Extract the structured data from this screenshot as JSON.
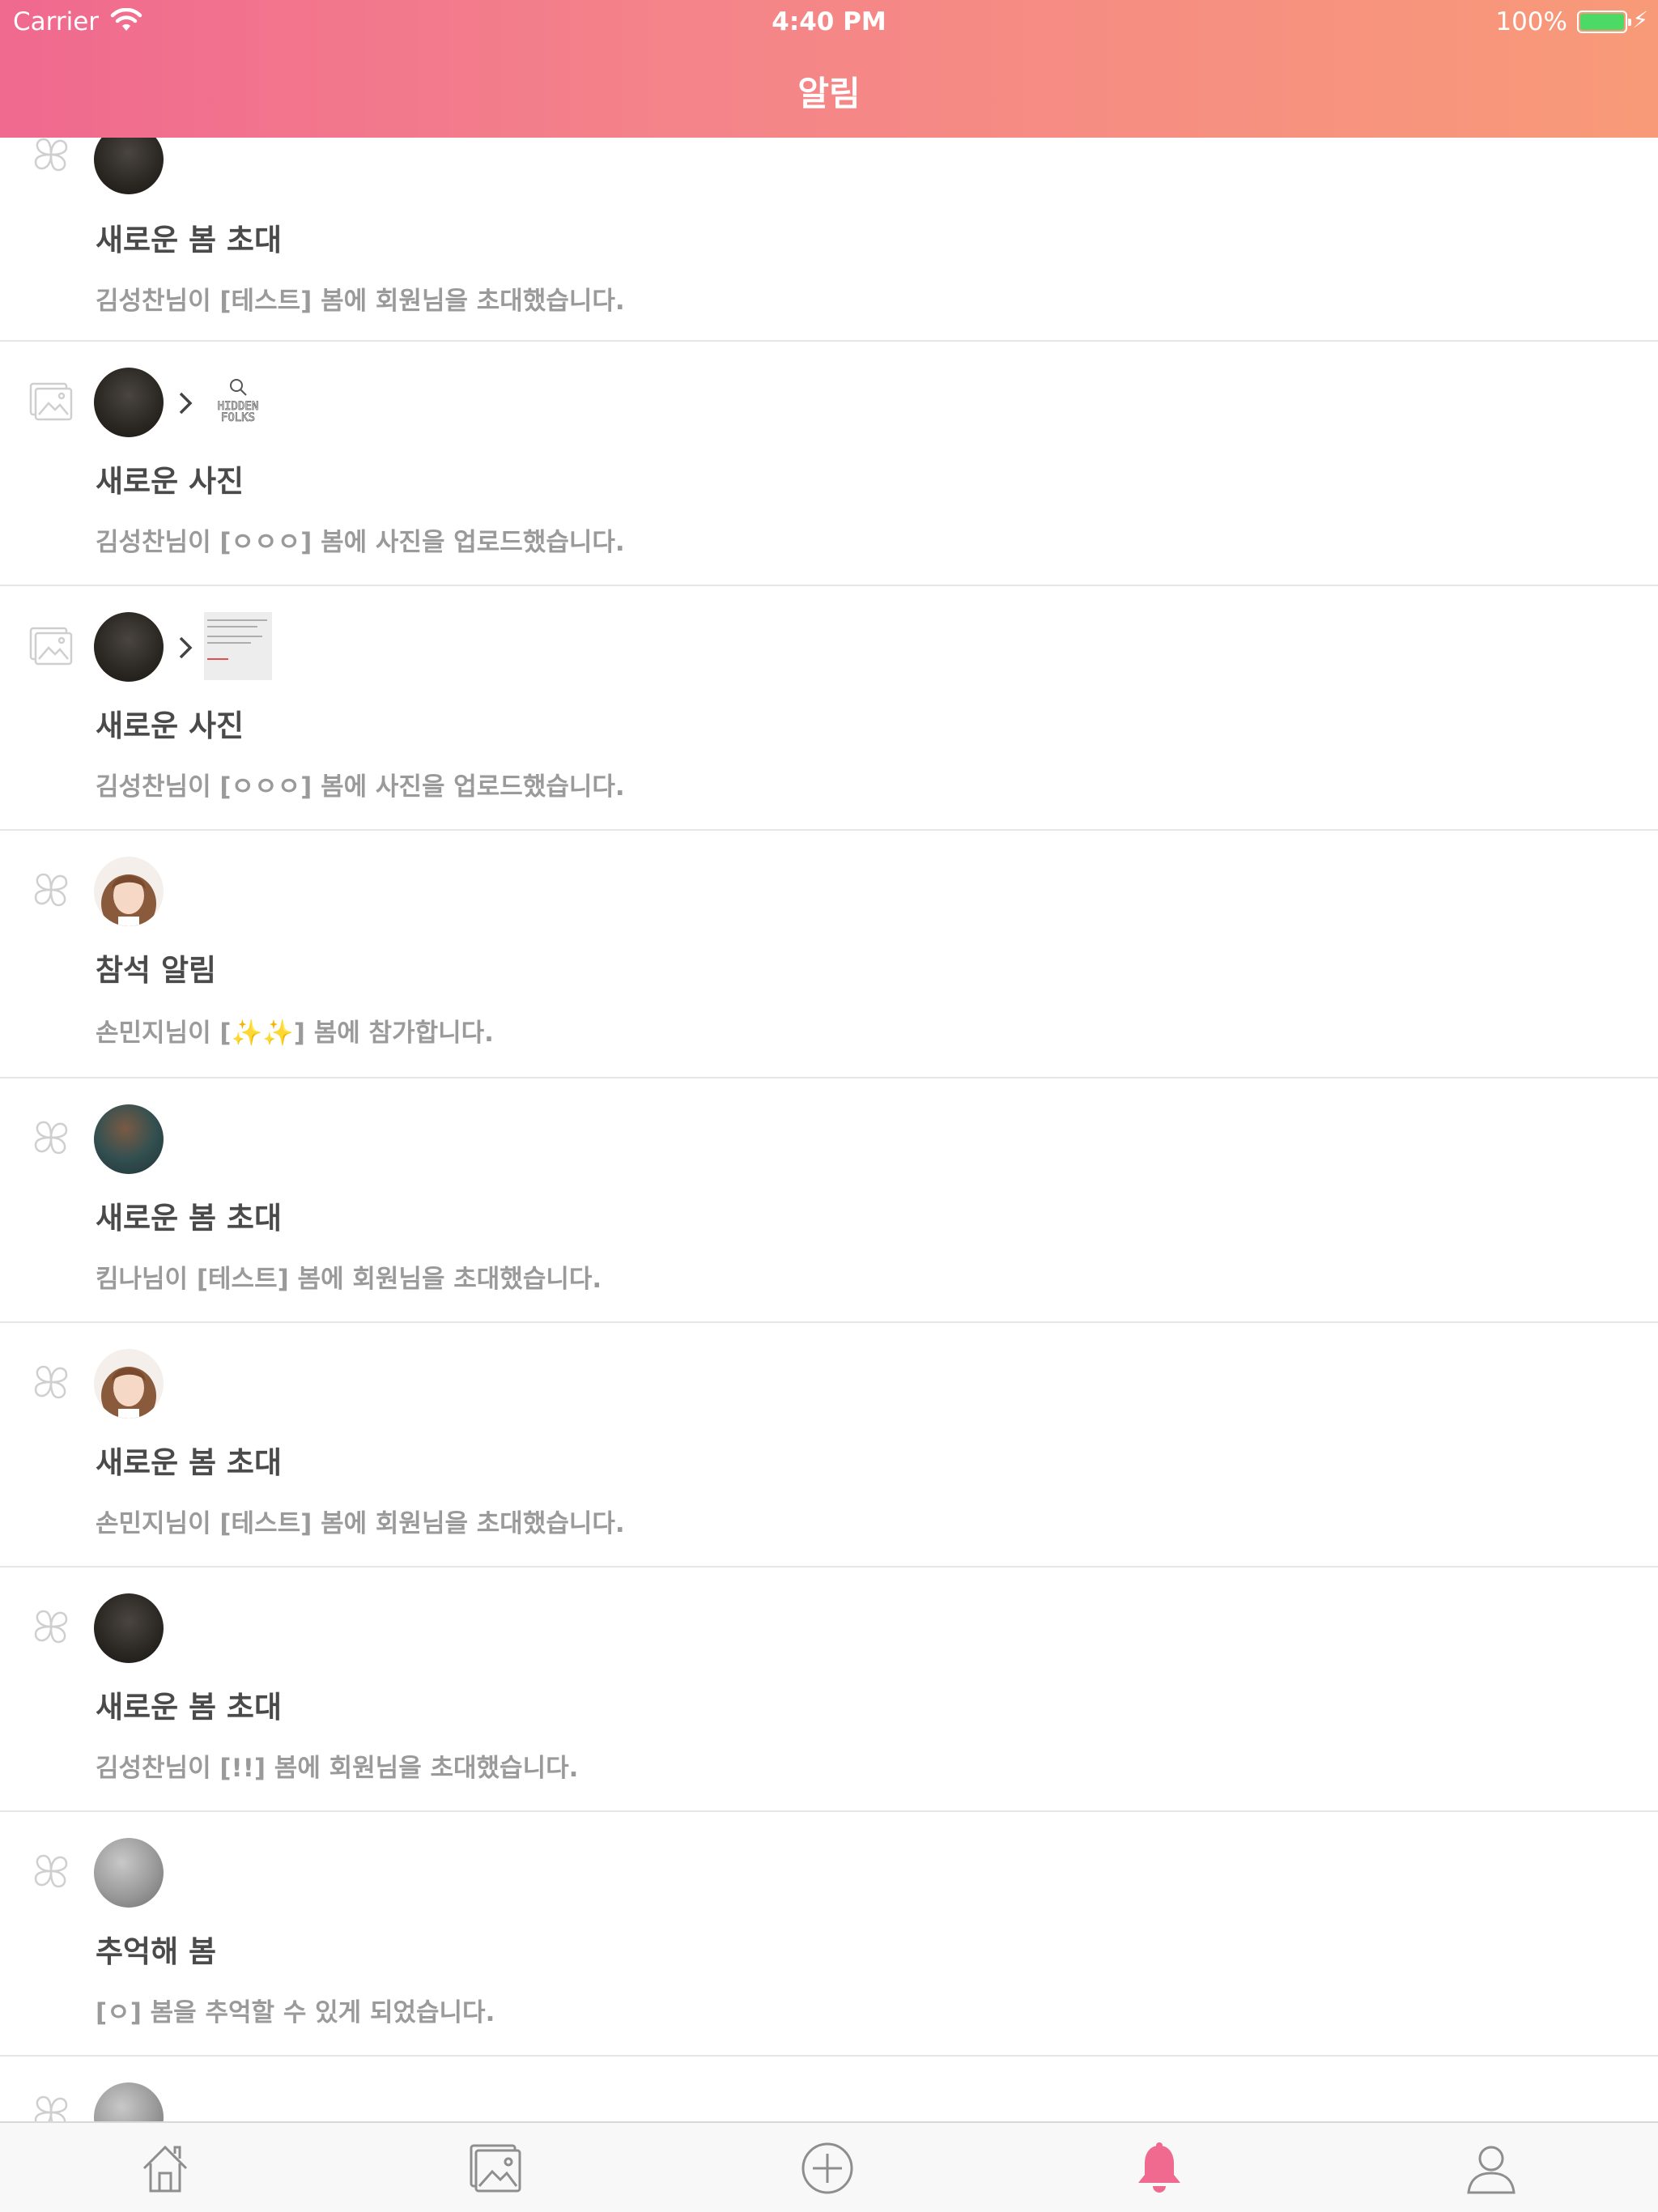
{
  "status_bar": {
    "carrier": "Carrier",
    "time": "4:40 PM",
    "battery": "100%"
  },
  "header": {
    "title": "알림"
  },
  "notifications": [
    {
      "type_icon": "clover-icon",
      "avatar": "avatar-dark",
      "title": "새로운 봄 초대",
      "desc": "김성찬님이 [테스트] 봄에 회원님을 초대했습니다."
    },
    {
      "type_icon": "photo-icon",
      "avatar": "avatar-dark",
      "thumb": "thumb-hidden-folks",
      "title": "새로운 사진",
      "desc": "김성찬님이 [ㅇㅇㅇ] 봄에 사진을 업로드했습니다."
    },
    {
      "type_icon": "photo-icon",
      "avatar": "avatar-dark",
      "thumb": "thumb-document",
      "title": "새로운 사진",
      "desc": "김성찬님이 [ㅇㅇㅇ] 봄에 사진을 업로드했습니다."
    },
    {
      "type_icon": "clover-icon",
      "avatar": "avatar-woman",
      "title": "참석 알림",
      "desc": "손민지님이 [✨✨] 봄에 참가합니다."
    },
    {
      "type_icon": "clover-icon",
      "avatar": "avatar-teal",
      "title": "새로운 봄 초대",
      "desc": "킴나님이 [테스트] 봄에 회원님을 초대했습니다."
    },
    {
      "type_icon": "clover-icon",
      "avatar": "avatar-woman",
      "title": "새로운 봄 초대",
      "desc": "손민지님이 [테스트] 봄에 회원님을 초대했습니다."
    },
    {
      "type_icon": "clover-icon",
      "avatar": "avatar-dark",
      "title": "새로운 봄 초대",
      "desc": "김성찬님이 [!!] 봄에 회원님을 초대했습니다."
    },
    {
      "type_icon": "clover-icon",
      "avatar": "avatar-gray",
      "title": "추억해 봄",
      "desc": "[ㅇ] 봄을 추억할 수 있게 되었습니다."
    },
    {
      "type_icon": "clover-icon",
      "avatar": "avatar-gray",
      "title": "",
      "desc": ""
    }
  ],
  "tabbar": {
    "tabs": [
      {
        "icon": "home-icon",
        "active": false
      },
      {
        "icon": "gallery-icon",
        "active": false
      },
      {
        "icon": "add-icon",
        "active": false
      },
      {
        "icon": "bell-icon",
        "active": true
      },
      {
        "icon": "profile-icon",
        "active": false
      }
    ]
  },
  "colors": {
    "header_start": "#f0698f",
    "header_end": "#f89a78",
    "active_tab": "#f0698f",
    "inactive_tab": "#8e8e8e",
    "title_text": "#4a4a4a",
    "desc_text": "#9a9a9a"
  }
}
